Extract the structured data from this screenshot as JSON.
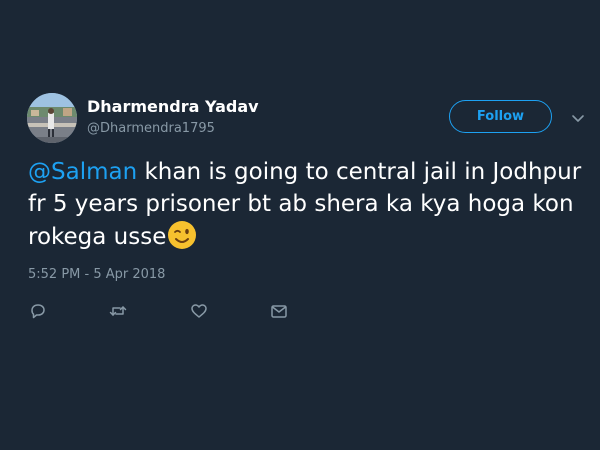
{
  "tweet": {
    "author": {
      "name": "Dharmendra Yadav",
      "handle": "@Dharmendra1795"
    },
    "follow_label": "Follow",
    "text": {
      "mention": "@Salman",
      "body": " khan is going to central jail in Jodhpur fr 5 years prisoner bt ab shera ka kya hoga kon rokega usse",
      "emoji": "winking-face-emoji"
    },
    "timestamp": "5:52 PM - 5 Apr 2018"
  },
  "icons": {
    "more": "chevron-down-icon",
    "reply": "reply-icon",
    "retweet": "retweet-icon",
    "like": "heart-icon",
    "message": "envelope-icon"
  },
  "colors": {
    "background": "#1b2735",
    "accent": "#1da1f2",
    "secondary_text": "#8899a6"
  }
}
